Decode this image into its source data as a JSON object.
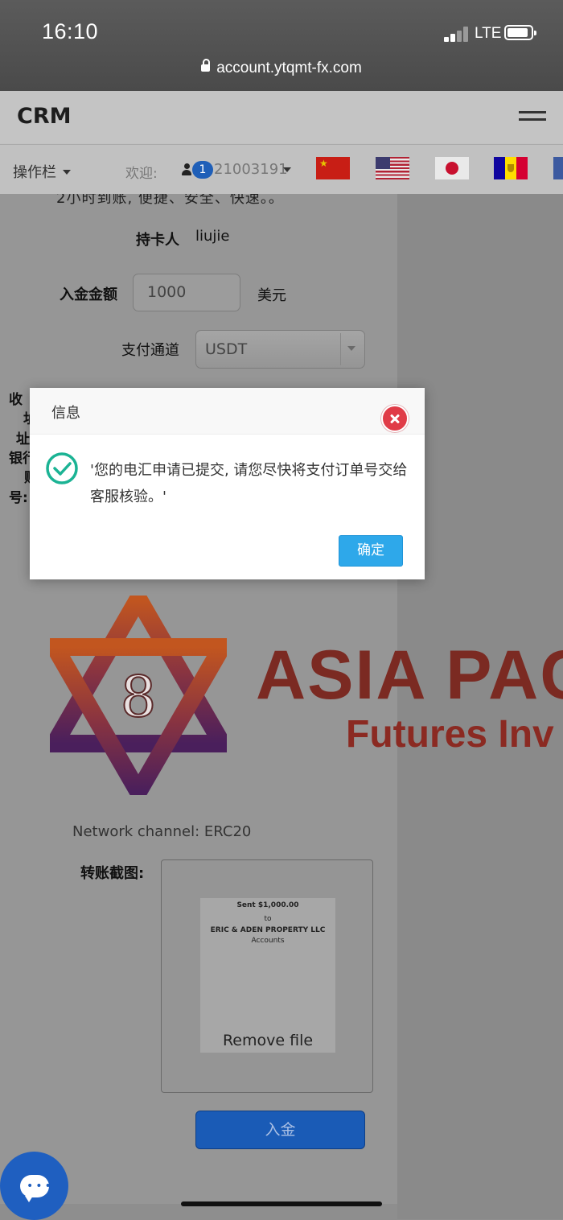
{
  "status_bar": {
    "time": "16:10",
    "network": "LTE",
    "url": "account.ytqmt-fx.com"
  },
  "header": {
    "logo": "CRM"
  },
  "nav": {
    "menu_label": "操作栏",
    "welcome": "欢迎:",
    "user_badge": "1",
    "user_id": "21003191"
  },
  "form": {
    "cut_text": "2小时到账, 便捷、安全、快速。。",
    "cardholder_label": "持卡人",
    "cardholder_value": "liujie",
    "amount_label": "入金金额",
    "amount_value": "1000",
    "amount_unit": "美元",
    "channel_label": "支付通道",
    "channel_value": "USDT",
    "left_chars": [
      "收",
      "址",
      "址",
      "银行",
      "账",
      "号:"
    ],
    "network_line": "Network channel: ERC20",
    "upload_label": "转账截图:",
    "thumb_lines": [
      "Sent $1,000.00",
      "to",
      "ERIC & ADEN PROPERTY LLC",
      "Accounts"
    ],
    "remove_file": "Remove file",
    "deposit_button": "入金"
  },
  "brand": {
    "name": "ASIA PAC",
    "sub": "Futures Inv"
  },
  "dialog": {
    "title": "信息",
    "message": "'您的电汇申请已提交, 请您尽快将支付订单号交给客服核验。'",
    "ok_label": "确定"
  },
  "colors": {
    "dialog_ok": "#2ea8ea",
    "close": "#e03b47",
    "success": "#1bb394",
    "deposit": "#1a5bb6",
    "brand": "#7b2a22"
  },
  "icons": [
    "lock-icon",
    "signal-icon",
    "battery-icon",
    "hamburger-icon",
    "user-icon",
    "caret-down-icon",
    "close-icon",
    "check-circle-icon",
    "chat-icon"
  ]
}
